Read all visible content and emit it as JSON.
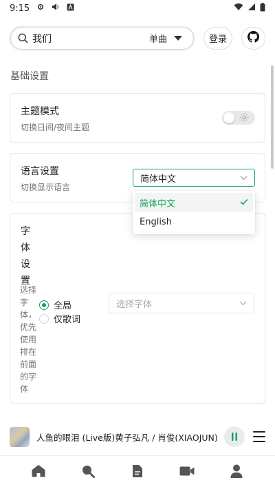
{
  "status_bar": {
    "time": "9:15"
  },
  "header": {
    "search_value": "我们",
    "search_type": "单曲",
    "login_label": "登录"
  },
  "section_title": "基础设置",
  "theme": {
    "title": "主题模式",
    "desc": "切换日间/夜间主题",
    "enabled": false
  },
  "language": {
    "title": "语言设置",
    "desc": "切换显示语言",
    "selected": "简体中文",
    "options": [
      "简体中文",
      "English"
    ]
  },
  "font": {
    "title_chars": [
      "字",
      "体",
      "设",
      "置"
    ],
    "desc": "选择字体，优先使用排在前面的字体",
    "radio_global": "全局",
    "radio_lyrics": "仅歌词",
    "placeholder": "选择字体"
  },
  "player": {
    "song": "人鱼的眼泪 (Live版)黄子弘凡 / 肖俊(XIAOJUN)"
  },
  "colors": {
    "accent": "#18a058"
  },
  "icons": {
    "nav": [
      "home-icon",
      "search-icon",
      "document-icon",
      "video-icon",
      "user-icon"
    ]
  }
}
